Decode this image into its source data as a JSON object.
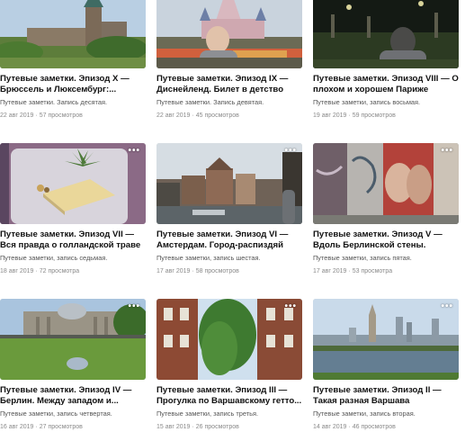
{
  "cards": [
    {
      "title": "Путевые заметки. Эпизод X — Брюссель и Люксембург:...",
      "subtitle": "Путевые заметки. Запись десятая.",
      "date": "22 авг 2019",
      "views": "57 просмотров",
      "menu_icon": "more-dots-icon",
      "menu_label": ""
    },
    {
      "title": "Путевые заметки. Эпизод IX — Диснейленд. Билет в детство",
      "subtitle": "Путевые заметки. Запись девятая.",
      "date": "22 авг 2019",
      "views": "45 просмотров",
      "menu_icon": "more-dots-icon",
      "menu_label": ""
    },
    {
      "title": "Путевые заметки. Эпизод VIII — О плохом и хорошем Париже",
      "subtitle": "Путевые заметки, запись восьмая.",
      "date": "19 авг 2019",
      "views": "59 просмотров",
      "menu_icon": "more-dots-icon",
      "menu_label": ""
    },
    {
      "title": "Путевые заметки. Эпизод VII — Вся правда о голландской траве",
      "subtitle": "Путевые заметки, запись седьмая.",
      "date": "18 авг 2019",
      "views": "72 просмотра",
      "menu_icon": "more-dots-icon",
      "menu_label": "•••"
    },
    {
      "title": "Путевые заметки. Эпизод VI — Амстердам. Город-распиздяй",
      "subtitle": "Путевые заметки, запись шестая.",
      "date": "17 авг 2019",
      "views": "58 просмотров",
      "menu_icon": "more-dots-icon",
      "menu_label": "•••"
    },
    {
      "title": "Путевые заметки. Эпизод V — Вдоль Берлинской стены.",
      "subtitle": "Путевые заметки, запись пятая.",
      "date": "17 авг 2019",
      "views": "53 просмотра",
      "menu_icon": "more-dots-icon",
      "menu_label": "•••"
    },
    {
      "title": "Путевые заметки. Эпизод IV — Берлин. Между западом и...",
      "subtitle": "Путевые заметки, запись четвертая.",
      "date": "16 авг 2019",
      "views": "27 просмотров",
      "menu_icon": "more-dots-icon",
      "menu_label": "•••"
    },
    {
      "title": "Путевые заметки. Эпизод III — Прогулка по Варшавскому гетто...",
      "subtitle": "Путевые заметки, запись третья.",
      "date": "15 авг 2019",
      "views": "26 просмотров",
      "menu_icon": "more-dots-icon",
      "menu_label": "•••"
    },
    {
      "title": "Путевые заметки. Эпизод II — Такая разная Варшава",
      "subtitle": "Путевые заметки, запись вторая.",
      "date": "14 авг 2019",
      "views": "46 просмотров",
      "menu_icon": "more-dots-icon",
      "menu_label": "•••"
    }
  ]
}
